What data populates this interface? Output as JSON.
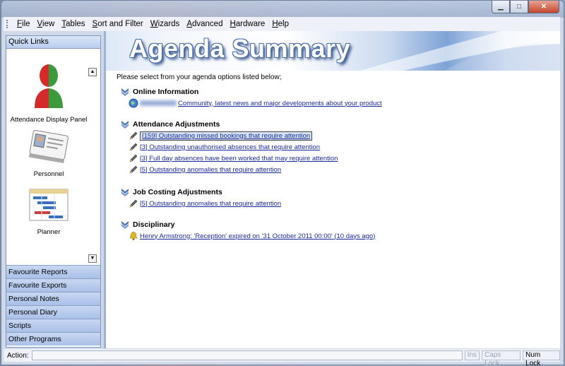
{
  "window": {
    "controls": {
      "minimize": "▁",
      "maximize": "□",
      "close": "✕"
    }
  },
  "menu": {
    "items": [
      {
        "label": "File",
        "accel": "F",
        "rest": "ile"
      },
      {
        "label": "View",
        "accel": "V",
        "rest": "iew"
      },
      {
        "label": "Tables",
        "accel": "T",
        "rest": "ables"
      },
      {
        "label": "Sort and Filter",
        "accel": "S",
        "rest": "ort and Filter"
      },
      {
        "label": "Wizards",
        "accel": "W",
        "rest": "izards"
      },
      {
        "label": "Advanced",
        "accel": "A",
        "rest": "dvanced"
      },
      {
        "label": "Hardware",
        "accel": "H",
        "rest": "ardware"
      },
      {
        "label": "Help",
        "accel": "H",
        "rest": "elp"
      }
    ]
  },
  "quick_links": {
    "header": "Quick Links",
    "scroll_up": "▲",
    "scroll_down": "▼",
    "tiles": [
      {
        "label": "Attendance Display Panel",
        "icon": "person-silhouette-icon"
      },
      {
        "label": "Personnel",
        "icon": "id-card-icon"
      },
      {
        "label": "Planner",
        "icon": "calendar-planner-icon"
      }
    ]
  },
  "nav_groups": [
    "Favourite Reports",
    "Favourite Exports",
    "Personal Notes",
    "Personal Diary",
    "Scripts",
    "Other Programs"
  ],
  "main": {
    "title": "Agenda Summary",
    "intro": "Please select from your agenda options listed below;",
    "sections": [
      {
        "heading": "Online Information",
        "items": [
          {
            "text": "Community, latest news and major developments about your product",
            "icon": "globe-icon",
            "has_blurred_prefix": true
          }
        ]
      },
      {
        "heading": "Attendance Adjustments",
        "items": [
          {
            "text": "[159] Outstanding missed bookings that require attention",
            "icon": "pencil-icon",
            "selected": true
          },
          {
            "text": "[3] Outstanding unauthorised absences that require attention",
            "icon": "pencil-icon"
          },
          {
            "text": "[3] Full day absences have been worked that may require attention",
            "icon": "pencil-icon"
          },
          {
            "text": "[5] Outstanding anomalies that require attention",
            "icon": "pencil-icon"
          }
        ]
      },
      {
        "heading": "Job Costing Adjustments",
        "items": [
          {
            "text": "[5] Outstanding anomalies that require attention",
            "icon": "pencil-icon"
          }
        ]
      },
      {
        "heading": "Disciplinary",
        "items": [
          {
            "text": "Henry Armstrong: 'Reception' expired on '31 October 2011 00:00' (10 days ago)",
            "icon": "bell-icon"
          }
        ]
      }
    ]
  },
  "status": {
    "action_label": "Action:",
    "ins": "Ins",
    "caps": "Caps Lock",
    "num": "Num Lock"
  }
}
